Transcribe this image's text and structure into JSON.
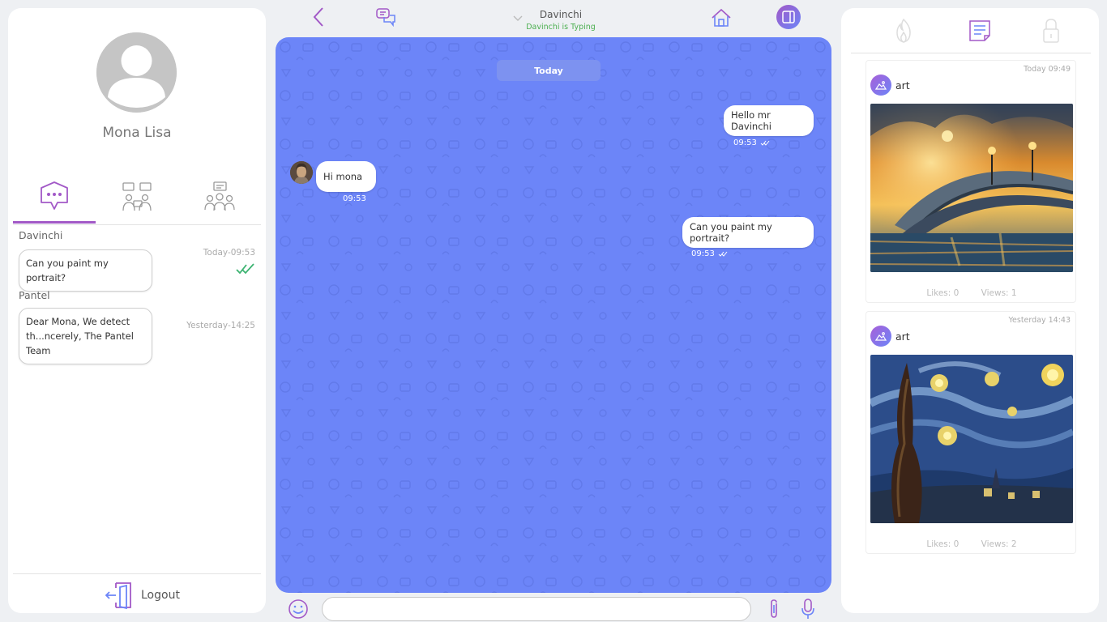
{
  "profile": {
    "name": "Mona Lisa"
  },
  "left_tabs": [
    {
      "icon": "chat-bubble-icon",
      "active": true
    },
    {
      "icon": "contacts-chat-icon",
      "active": false
    },
    {
      "icon": "group-chat-icon",
      "active": false
    }
  ],
  "conversations": [
    {
      "sender": "Davinchi",
      "preview": "Can you paint my portrait?",
      "time": "Today-09:53",
      "read": true
    },
    {
      "sender": "Pantel",
      "preview_lines": [
        "Dear Mona, We detect",
        "th...ncerely, The Pantel",
        "Team"
      ],
      "time": "Yesterday-14:25"
    }
  ],
  "logout_label": "Logout",
  "header": {
    "contact_name": "Davinchi",
    "contact_status": "Davinchi is Typing"
  },
  "chat": {
    "day_label": "Today",
    "messages": [
      {
        "text": "Hello mr Davinchi",
        "time": "09:53",
        "outgoing": true
      },
      {
        "text": "Hi mona",
        "time": "09:53",
        "outgoing": false
      },
      {
        "text": "Can you paint my portrait?",
        "time": "09:53",
        "outgoing": true
      }
    ],
    "input_placeholder": ""
  },
  "posts": [
    {
      "time": "Today 09:49",
      "tag": "art",
      "likes": "Likes: 0",
      "views": "Views: 1",
      "image": "night-bridge-painting"
    },
    {
      "time": "Yesterday 14:43",
      "tag": "art",
      "likes": "Likes: 0",
      "views": "Views: 2",
      "image": "starry-night-painting"
    }
  ],
  "colors": {
    "accent": "#a259c7",
    "chat_bg": "#6c85f8",
    "status_green": "#4caf50"
  }
}
